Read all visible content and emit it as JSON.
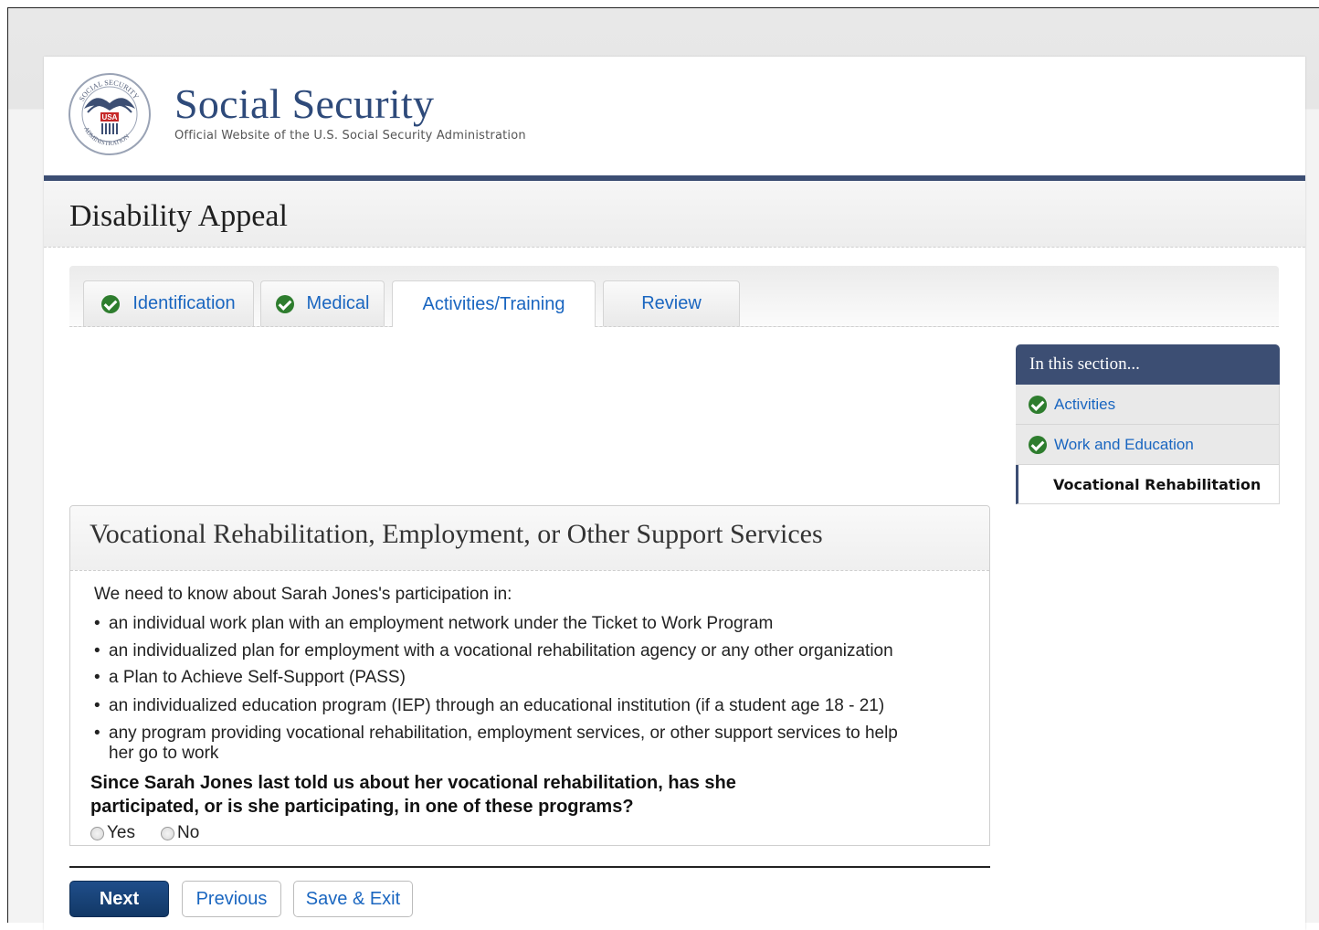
{
  "header": {
    "site_title": "Social Security",
    "site_subtitle": "Official Website of the U.S. Social Security Administration",
    "seal_text": "SOCIAL SECURITY ADMINISTRATION USA"
  },
  "page_title": "Disability Appeal",
  "tabs": [
    {
      "label": "Identification",
      "completed": true
    },
    {
      "label": "Medical",
      "completed": true
    },
    {
      "label": "Activities/Training",
      "active": true
    },
    {
      "label": "Review"
    }
  ],
  "sidebar": {
    "heading": "In this section...",
    "items": [
      {
        "label": "Activities",
        "completed": true
      },
      {
        "label": "Work and Education",
        "completed": true
      },
      {
        "label": "Vocational Rehabilitation",
        "current": true
      }
    ]
  },
  "panel": {
    "title": "Vocational Rehabilitation, Employment, or Other Support Services",
    "intro": "We need to know about Sarah Jones's participation in:",
    "bullets": [
      "an individual work plan with an employment network under the Ticket to Work Program",
      "an individualized plan for employment with a vocational rehabilitation agency or any other organization",
      "a Plan to Achieve Self-Support (PASS)",
      "an individualized education program (IEP) through an educational institution (if a student age 18 - 21)",
      "any program providing vocational rehabilitation, employment services, or other support services to help her go to work"
    ],
    "question": "Since Sarah Jones last told us about her vocational rehabilitation, has she participated, or is she participating, in one of these programs?",
    "options": {
      "yes": "Yes",
      "no": "No"
    }
  },
  "buttons": {
    "next": "Next",
    "previous": "Previous",
    "save_exit": "Save & Exit"
  },
  "colors": {
    "brand_navy": "#3c4e73",
    "link_blue": "#1a66c0",
    "check_green": "#2e7d2e"
  }
}
